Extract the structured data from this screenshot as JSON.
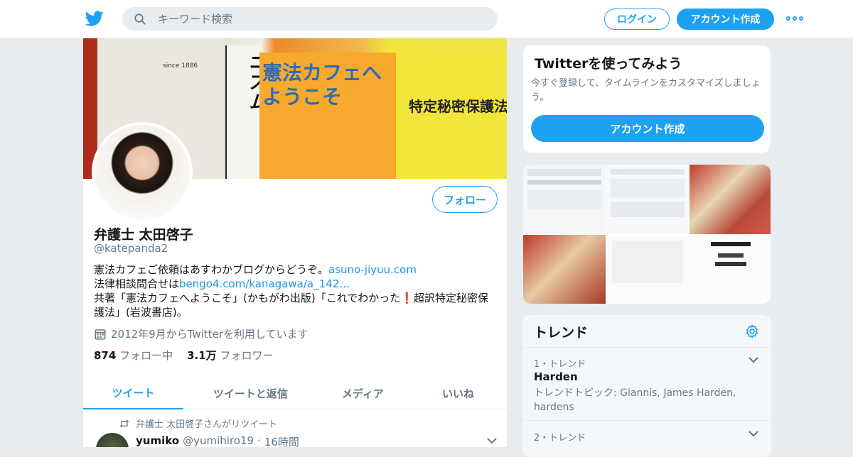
{
  "header": {
    "search_placeholder": "キーワード検索",
    "login_label": "ログイン",
    "signup_label": "アカウント作成",
    "brand_color": "#1da1f2"
  },
  "banner": {
    "book1_text": "since 1886",
    "book2_title": "日本のフェミニズム",
    "book3_title": "憲法カフェへようこそ",
    "book4_title": "特定秘密保護法"
  },
  "profile": {
    "follow_label": "フォロー",
    "name": "弁護士 太田啓子",
    "handle": "@katepanda2",
    "bio_line1_text": "憲法カフェご依頼はあすわかブログからどうぞ。",
    "bio_line1_link": "asuno-jiyuu.com",
    "bio_line2_text": "法律相談問合せは",
    "bio_line2_link": "bengo4.com/kanagawa/a_142…",
    "bio_line3a": "共著「憲法カフェへようこそ」(かもがわ出版)「これでわかった",
    "bio_line3_mark": "❗",
    "bio_line3b": "超訳特定秘密保",
    "bio_line4": "護法」(岩波書店)。",
    "joined": "2012年9月からTwitterを利用しています",
    "following_count": "874",
    "following_label": "フォロー中",
    "followers_count": "3.1万",
    "followers_label": "フォロワー"
  },
  "tabs": [
    {
      "label": "ツイート",
      "active": true
    },
    {
      "label": "ツイートと返信",
      "active": false
    },
    {
      "label": "メディア",
      "active": false
    },
    {
      "label": "いいね",
      "active": false
    }
  ],
  "tweet": {
    "retweet_note": "弁護士 太田啓子さんがリツイート",
    "user_name": "yumiko",
    "user_handle": "@yumihiro19",
    "time": "16時間"
  },
  "signup_card": {
    "title": "Twitterを使ってみよう",
    "text": "今すぐ登録して、タイムラインをカスタマイズしましょう。",
    "button": "アカウント作成"
  },
  "trends": {
    "title": "トレンド",
    "items": [
      {
        "rank": "1・トレンド",
        "term": "Harden",
        "desc": "トレンドトピック: Giannis, James Harden, hardens"
      },
      {
        "rank": "2・トレンド",
        "term": "",
        "desc": ""
      }
    ]
  }
}
